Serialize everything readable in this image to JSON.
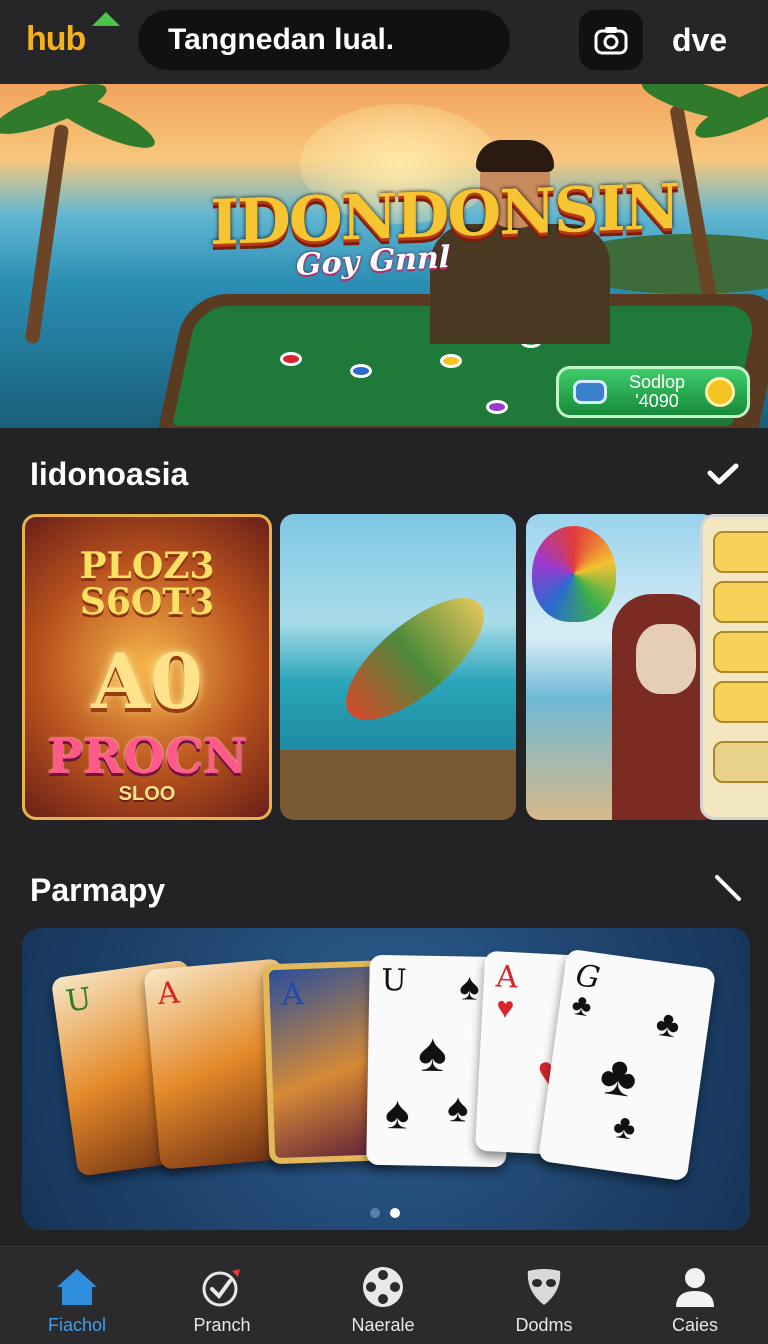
{
  "header": {
    "logo_text": "hub",
    "search_text": "Tangnedan lual.",
    "camera_icon": "camera-icon",
    "user_label": "dve"
  },
  "hero": {
    "title": "IDONDONSIN",
    "subtitle": "Goy Gnnl",
    "badge_line1": "Sodlop",
    "badge_line2": "'4090"
  },
  "section1": {
    "title": "Iidonoasia",
    "icon": "check-icon"
  },
  "promo_card": {
    "line1": "PLOZ3",
    "line2": "S6OT3",
    "line3": "A0",
    "line4": "PROCN",
    "line5": "SLOO"
  },
  "section2": {
    "title": "Parmapy",
    "icon": "slash-icon"
  },
  "cards_banner": {
    "cards": [
      {
        "rank": "U"
      },
      {
        "rank": "A"
      },
      {
        "rank": "A"
      },
      {
        "rank": "U"
      },
      {
        "rank": "A"
      },
      {
        "rank": "G"
      }
    ],
    "active_page": 2,
    "page_count": 2
  },
  "bottom_nav": {
    "items": [
      {
        "label": "Fiachol",
        "icon": "home-icon",
        "active": true
      },
      {
        "label": "Pranch",
        "icon": "target-check-icon",
        "active": false
      },
      {
        "label": "Naerale",
        "icon": "film-reel-icon",
        "active": false
      },
      {
        "label": "Dodms",
        "icon": "mask-icon",
        "active": false
      },
      {
        "label": "Caies",
        "icon": "user-icon",
        "active": false
      }
    ]
  },
  "colors": {
    "accent": "#3ea0e8",
    "background": "#232325",
    "logo": "#f6b21b"
  }
}
